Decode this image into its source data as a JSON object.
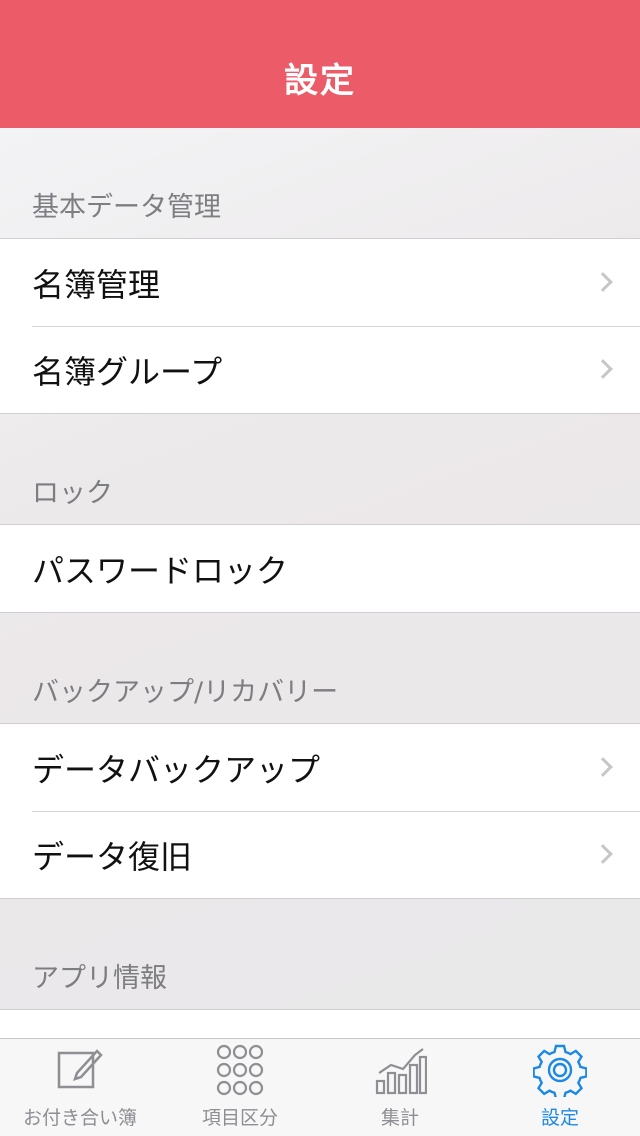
{
  "navbar": {
    "title": "設定"
  },
  "sections": [
    {
      "header": "基本データ管理",
      "rows": [
        {
          "label": "名簿管理",
          "chevron": true
        },
        {
          "label": "名簿グループ",
          "chevron": true
        }
      ]
    },
    {
      "header": "ロック",
      "rows": [
        {
          "label": "パスワードロック",
          "chevron": false
        }
      ]
    },
    {
      "header": "バックアップ/リカバリー",
      "rows": [
        {
          "label": "データバックアップ",
          "chevron": true
        },
        {
          "label": "データ復旧",
          "chevron": true
        }
      ]
    },
    {
      "header": "アプリ情報",
      "rows": []
    }
  ],
  "tabbar": {
    "tabs": [
      {
        "label": "お付き合い簿",
        "icon": "compose-icon",
        "active": false
      },
      {
        "label": "項目区分",
        "icon": "grid-dots-icon",
        "active": false
      },
      {
        "label": "集計",
        "icon": "bar-chart-icon",
        "active": false
      },
      {
        "label": "設定",
        "icon": "gear-icon",
        "active": true
      }
    ]
  },
  "colors": {
    "navbar": "#ec5c68",
    "active_tab": "#1e88e5",
    "inactive_tab": "#8e8e93"
  }
}
